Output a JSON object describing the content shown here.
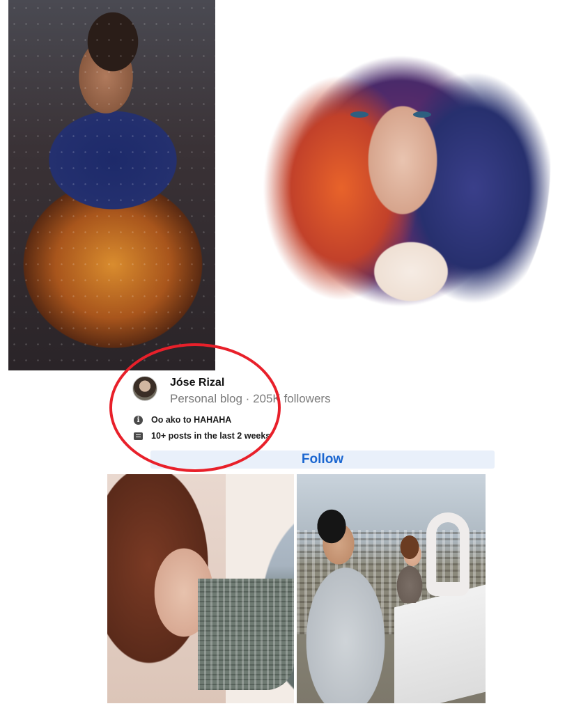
{
  "images": [
    {
      "name": "man-with-sabertooth-tiger-art",
      "kind": "photo"
    },
    {
      "name": "woman-watercolor-portrait",
      "kind": "photo"
    },
    {
      "name": "girl-looking-through-window",
      "kind": "photo"
    },
    {
      "name": "couple-with-toilet-seat-frame",
      "kind": "photo"
    }
  ],
  "page_card": {
    "name": "Jóse Rizal",
    "meta": "Personal blog · 205K followers",
    "intro": "Oo ako to HAHAHA",
    "posts_activity": "10+ posts in the last 2 weeks",
    "follow_label": "Follow",
    "intro_icon": "info-icon",
    "posts_icon": "posts-icon"
  },
  "colors": {
    "follow_text": "#1a66d0",
    "follow_bg": "#e9f0fa",
    "highlight_ring": "#e8202a",
    "meta_text": "#7a7a7a"
  }
}
